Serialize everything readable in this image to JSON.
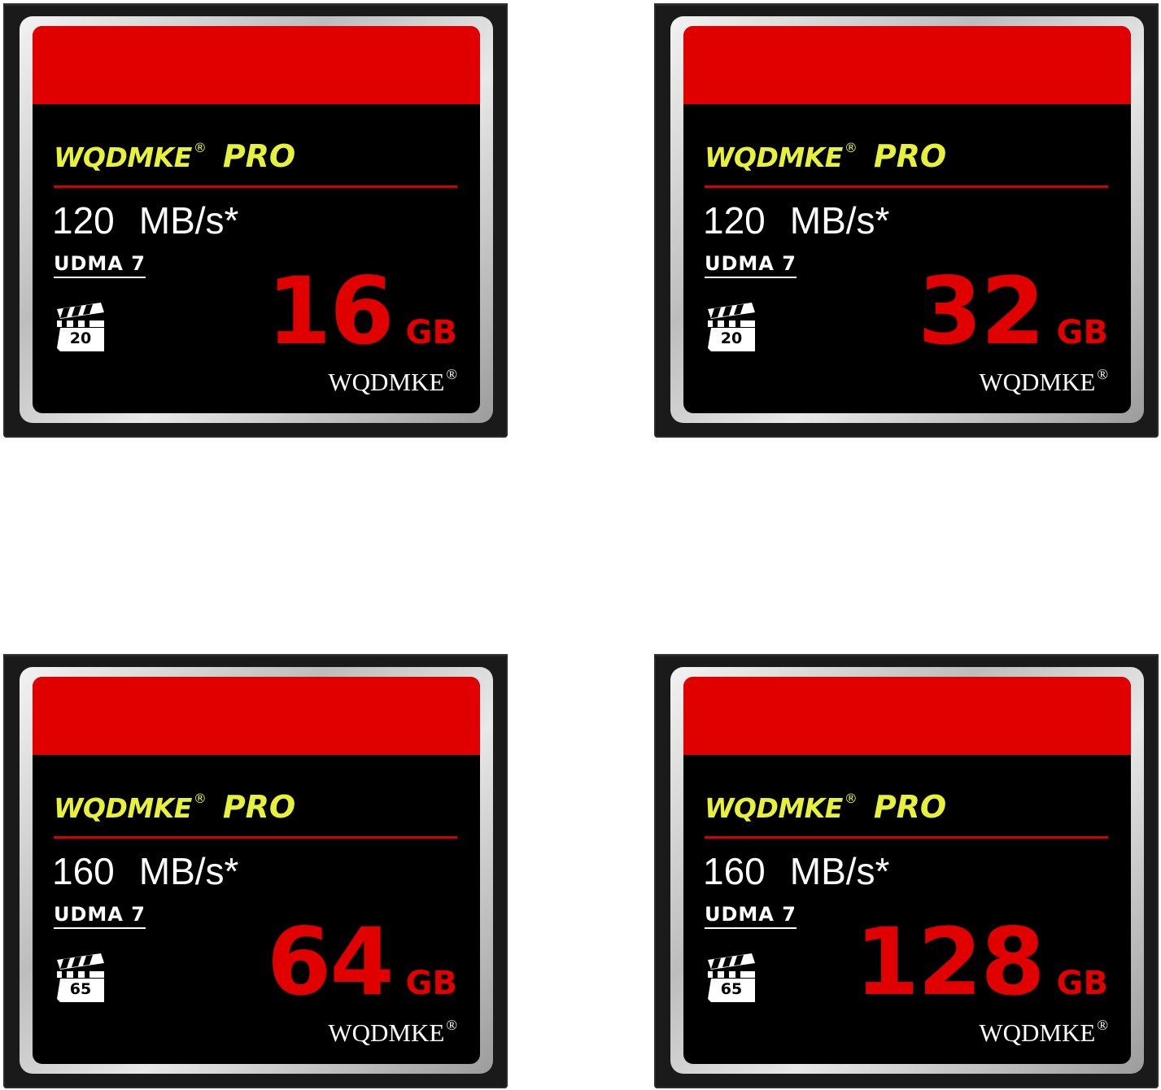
{
  "cards": [
    {
      "brand": "WQDMKE",
      "registered": "®",
      "line": "PRO",
      "speed_value": "120",
      "speed_unit": "MB/s*",
      "udma": "UDMA 7",
      "vpg": "20",
      "capacity": "16",
      "capacity_unit": "GB",
      "footer_brand": "WQDMKE",
      "footer_registered": "®"
    },
    {
      "brand": "WQDMKE",
      "registered": "®",
      "line": "PRO",
      "speed_value": "120",
      "speed_unit": "MB/s*",
      "udma": "UDMA 7",
      "vpg": "20",
      "capacity": "32",
      "capacity_unit": "GB",
      "footer_brand": "WQDMKE",
      "footer_registered": "®"
    },
    {
      "brand": "WQDMKE",
      "registered": "®",
      "line": "PRO",
      "speed_value": "160",
      "speed_unit": "MB/s*",
      "udma": "UDMA 7",
      "vpg": "65",
      "capacity": "64",
      "capacity_unit": "GB",
      "footer_brand": "WQDMKE",
      "footer_registered": "®"
    },
    {
      "brand": "WQDMKE",
      "registered": "®",
      "line": "PRO",
      "speed_value": "160",
      "speed_unit": "MB/s*",
      "udma": "UDMA 7",
      "vpg": "65",
      "capacity": "128",
      "capacity_unit": "GB",
      "footer_brand": "WQDMKE",
      "footer_registered": "®"
    }
  ],
  "colors": {
    "band_red": "#e10000",
    "brand_yellow": "#e6f23a",
    "label_black": "#000000",
    "shell_black": "#1a1a1a"
  },
  "icons": {
    "vpg": "clapperboard-icon"
  }
}
